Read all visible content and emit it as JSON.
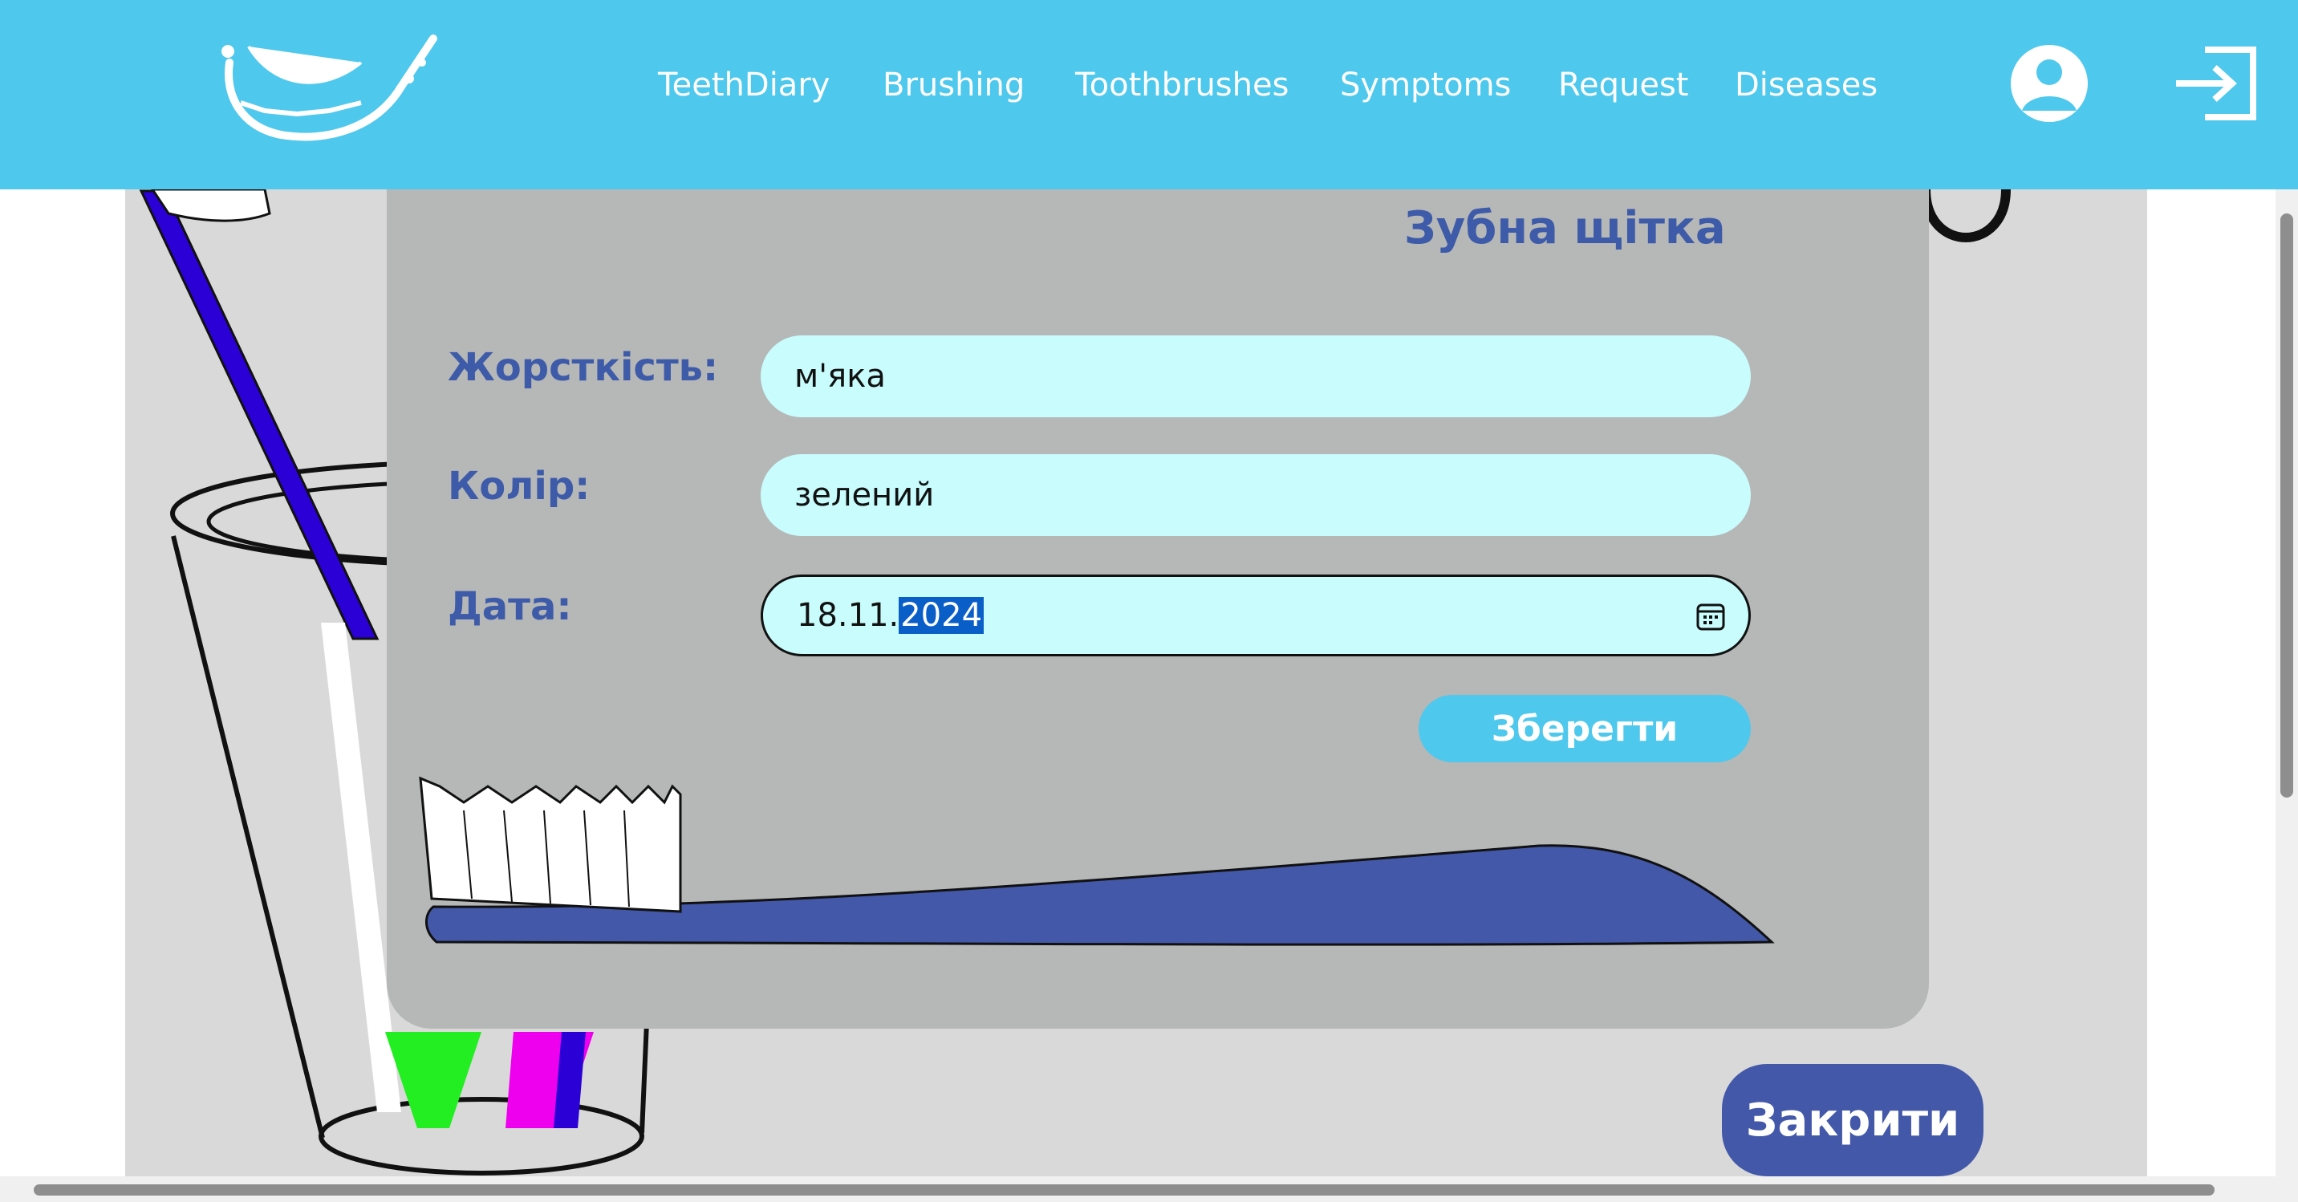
{
  "header": {
    "logo_icon": "tooth-smile-logo",
    "nav": [
      {
        "label": "TeethDiary"
      },
      {
        "label": "Brushing"
      },
      {
        "label": "Toothbrushes"
      },
      {
        "label": "Symptoms"
      },
      {
        "label": "Request"
      },
      {
        "label": "Diseases"
      }
    ],
    "user_icon": "user-icon",
    "logout_icon": "logout-icon"
  },
  "modal": {
    "title": "Зубна щітка",
    "fields": [
      {
        "label": "Жорсткість:",
        "value": "м'яка"
      },
      {
        "label": "Колір:",
        "value": "зелений"
      },
      {
        "label": "Дата:",
        "value_prefix": "18.11.",
        "value_selected": "2024"
      }
    ],
    "save_label": "Зберегти"
  },
  "close_label": "Закрити",
  "colors": {
    "header": "#4ec8ec",
    "modal": "#b6b7b7",
    "input": "#c8fcfd",
    "accent_text": "#3d5ba8",
    "close_button": "#4358a8"
  }
}
